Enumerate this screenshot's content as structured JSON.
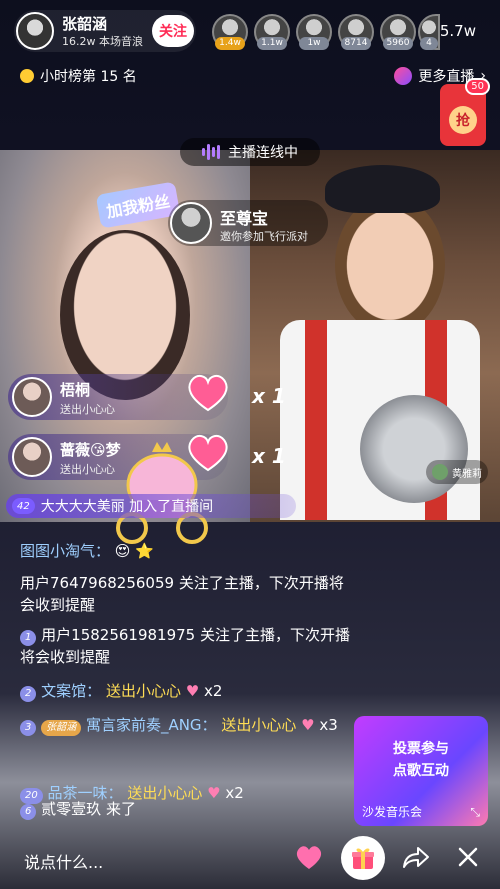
{
  "host": {
    "name": "张韶涵",
    "subtitle": "16.2w 本场音浪",
    "follow_label": "关注"
  },
  "viewers": [
    {
      "badge": "1.4w",
      "badge_color": "#e7a21a"
    },
    {
      "badge": "1.1w",
      "badge_color": "#7f8797"
    },
    {
      "badge": "1w",
      "badge_color": "#7f8797"
    },
    {
      "badge": "8714",
      "badge_color": "#7f8797"
    },
    {
      "badge": "5960",
      "badge_color": "#7f8797"
    },
    {
      "badge": "4",
      "badge_color": "#7f8797"
    }
  ],
  "viewer_count": "5.7w",
  "rank_label": "小时榜第 15 名",
  "more_live_label": "更多直播",
  "redpacket": {
    "label": "抢",
    "count": "50"
  },
  "link_label": "主播连线中",
  "video": {
    "tag": "加我粉丝",
    "vip": {
      "name": "至尊宝",
      "subtitle": "邀你参加飞行派对"
    },
    "right_user": "黄雅莉",
    "gift_rows": [
      {
        "name": "梧桐",
        "action": "送出小心心",
        "multiplier": "x 1"
      },
      {
        "name": "蔷薇😘梦",
        "action": "送出小心心",
        "multiplier": "x 1"
      }
    ],
    "join": {
      "level": "42",
      "text": "大大大大美丽  加入了直播间"
    }
  },
  "chat": [
    {
      "text": "图图小淘气：",
      "emoji": "😍 ⭐"
    },
    {
      "text": "用户7647968256059 关注了主播，下次开播将会收到提醒"
    },
    {
      "level": "1",
      "text": "用户1582561981975 关注了主播，下次开播将会收到提醒"
    },
    {
      "level": "2",
      "user": "文案馆：",
      "action": "送出小心心",
      "mult": "x2"
    },
    {
      "level": "3",
      "fan_badge": "张韶涵",
      "user": "寓言家前奏_ANG：",
      "action": "送出小心心",
      "mult": "x3"
    },
    {
      "level": "20",
      "user": "品茶一味：",
      "action": "送出小心心",
      "mult": "x2"
    },
    {
      "level": "6",
      "user": "贰零壹玖",
      "action": "来了"
    }
  ],
  "vote_card": {
    "line1": "投票参与",
    "line2": "点歌互动",
    "footer": "沙发音乐会"
  },
  "bottom": {
    "input_placeholder": "说点什么..."
  }
}
